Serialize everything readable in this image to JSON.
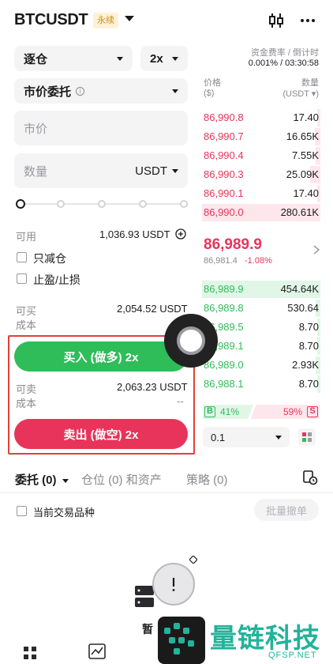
{
  "header": {
    "symbol": "BTCUSDT",
    "badge": "永续"
  },
  "funding": {
    "label": "资金费率 / 倒计时",
    "value": "0.001% / 03:30:58"
  },
  "controls": {
    "margin_mode": "逐仓",
    "leverage": "2x",
    "order_type": "市价委托",
    "price_placeholder": "市价",
    "qty_placeholder": "数量",
    "qty_unit": "USDT"
  },
  "available": {
    "label": "可用",
    "value": "1,036.93 USDT"
  },
  "options": {
    "reduce_only": "只减仓",
    "tp_sl": "止盈/止损"
  },
  "buy": {
    "can_label": "可买",
    "cost_label": "成本",
    "can_value": "2,054.52 USDT",
    "button": "买入 (做多) 2x"
  },
  "sell": {
    "can_label": "可卖",
    "cost_label": "成本",
    "can_value": "2,063.23 USDT",
    "cost_value": "--",
    "button": "卖出 (做空) 2x"
  },
  "orderbook": {
    "price_header": "价格",
    "price_unit": "($)",
    "qty_header": "数量",
    "qty_unit": "(USDT ▾)",
    "asks": [
      {
        "price": "86,990.8",
        "qty": "17.40",
        "depth": 0.03
      },
      {
        "price": "86,990.7",
        "qty": "16.65K",
        "depth": 0.05
      },
      {
        "price": "86,990.4",
        "qty": "7.55K",
        "depth": 0.04
      },
      {
        "price": "86,990.3",
        "qty": "25.09K",
        "depth": 0.09
      },
      {
        "price": "86,990.1",
        "qty": "17.40",
        "depth": 0.03
      },
      {
        "price": "86,990.0",
        "qty": "280.61K",
        "depth": 1.0
      }
    ],
    "last_price": "86,989.9",
    "mark_price": "86,981.4",
    "change": "-1.08%",
    "bids": [
      {
        "price": "86,989.9",
        "qty": "454.64K",
        "depth": 1.0
      },
      {
        "price": "86,989.8",
        "qty": "530.64",
        "depth": 0.04
      },
      {
        "price": "86,989.5",
        "qty": "8.70",
        "depth": 0.03
      },
      {
        "price": "86,989.1",
        "qty": "8.70",
        "depth": 0.03
      },
      {
        "price": "86,989.0",
        "qty": "2.93K",
        "depth": 0.04
      },
      {
        "price": "86,988.1",
        "qty": "8.70",
        "depth": 0.03
      }
    ],
    "buy_ratio_tag": "B",
    "buy_ratio": "41%",
    "sell_ratio": "59%",
    "sell_ratio_tag": "S",
    "precision": "0.1"
  },
  "tabs": {
    "orders": "委托 (0)",
    "positions": "仓位 (0)",
    "assets": "和资产",
    "strategy": "策略 (0)"
  },
  "filters": {
    "current_symbol": "当前交易品种",
    "bulk_cancel": "批量撤单"
  },
  "empty": {
    "text": "暂"
  },
  "watermark": {
    "name": "量链科技",
    "site": "QFSP.NET"
  },
  "colors": {
    "buy": "#2ebd59",
    "sell": "#e8345a",
    "badge": "#d28a12"
  }
}
